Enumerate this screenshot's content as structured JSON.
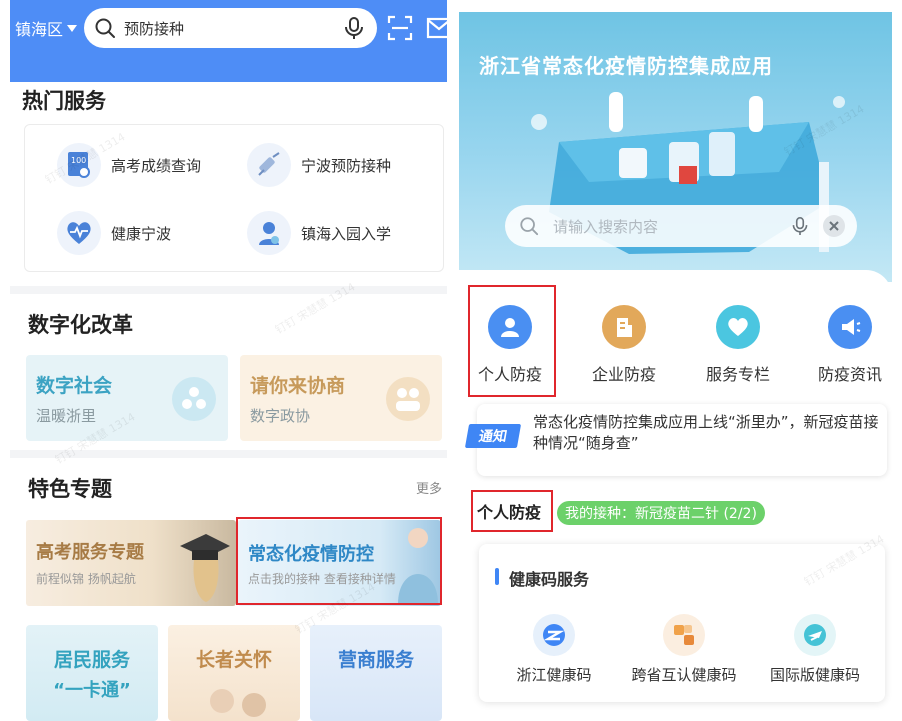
{
  "left": {
    "topbar": {
      "district": "镇海区",
      "search_text": "预防接种"
    },
    "hot_services": {
      "title": "热门服务",
      "items": [
        {
          "label": "高考成绩查询",
          "icon": "score-report-icon"
        },
        {
          "label": "宁波预防接种",
          "icon": "syringe-icon"
        },
        {
          "label": "健康宁波",
          "icon": "heart-pulse-icon"
        },
        {
          "label": "镇海入园入学",
          "icon": "student-icon"
        }
      ]
    },
    "digital_reform": {
      "title": "数字化改革",
      "cards": [
        {
          "title": "数字社会",
          "subtitle": "温暖浙里"
        },
        {
          "title": "请你来协商",
          "subtitle": "数字政协"
        }
      ]
    },
    "featured": {
      "title": "特色专题",
      "more": "更多",
      "topics": [
        {
          "title": "高考服务专题",
          "subtitle": "前程似锦  扬帆起航"
        },
        {
          "title": "常态化疫情防控",
          "subtitle": "点击我的接种 查看接种详情"
        }
      ]
    },
    "bottom_cards": [
      {
        "title": "居民服务",
        "title2": "“一卡通”"
      },
      {
        "title": "长者关怀",
        "title2": ""
      },
      {
        "title": "营商服务",
        "title2": ""
      }
    ],
    "watermark": "钉钉 宋慧慧 1314"
  },
  "right": {
    "banner_title": "浙江省常态化疫情防控集成应用",
    "search_placeholder": "请输入搜索内容",
    "categories": [
      {
        "label": "个人防疫",
        "icon": "person-icon",
        "color": "#4a8ff2"
      },
      {
        "label": "企业防疫",
        "icon": "building-icon",
        "color": "#e2a85a"
      },
      {
        "label": "服务专栏",
        "icon": "heart-icon",
        "color": "#4bc6e0"
      },
      {
        "label": "防疫资讯",
        "icon": "megaphone-icon",
        "color": "#4a8ff2"
      }
    ],
    "notice": {
      "tag": "通知",
      "text": "常态化疫情防控集成应用上线“浙里办”，新冠疫苗接种情况“随身查”"
    },
    "personal": {
      "label": "个人防疫",
      "vaccination": "我的接种：新冠疫苗二针 (2/2)"
    },
    "health_codes": {
      "title": "健康码服务",
      "items": [
        {
          "label": "浙江健康码",
          "icon": "zhejiang-code-icon"
        },
        {
          "label": "跨省互认健康码",
          "icon": "mutual-code-icon"
        },
        {
          "label": "国际版健康码",
          "icon": "plane-code-icon"
        }
      ]
    }
  },
  "colors": {
    "topbar_blue": "#4e8df6",
    "highlight_red": "#e0262c",
    "notice_blue": "#3f86f5",
    "pill_green": "#6cd16a"
  }
}
